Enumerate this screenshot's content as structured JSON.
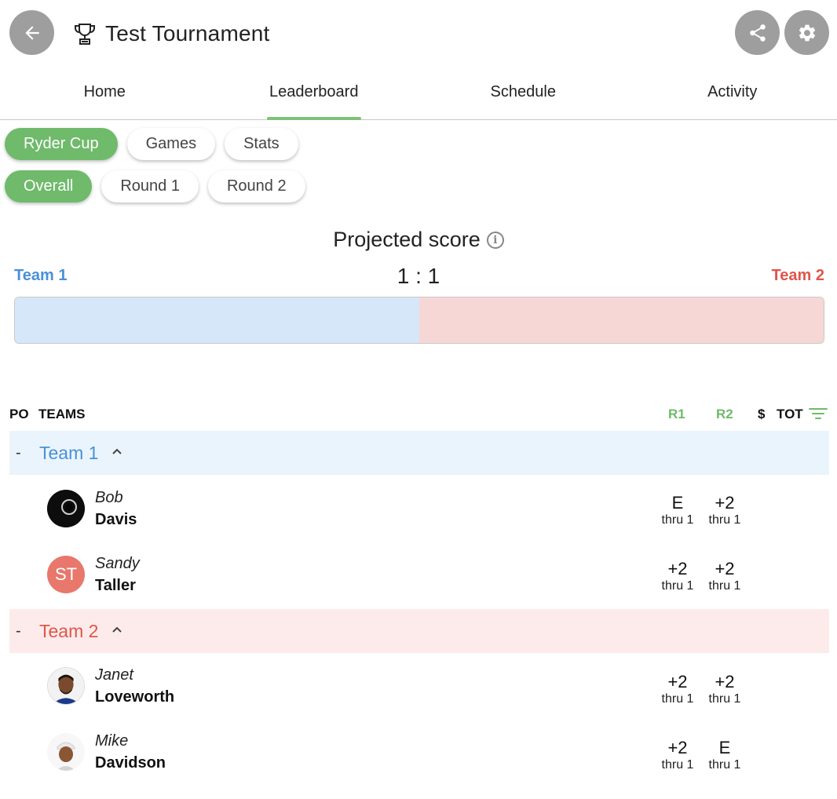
{
  "header": {
    "title": "Test Tournament",
    "icons": {
      "back": "arrow-left-icon",
      "trophy": "trophy-icon",
      "share": "share-icon",
      "settings": "gear-icon"
    }
  },
  "tabs": [
    {
      "label": "Home",
      "active": false
    },
    {
      "label": "Leaderboard",
      "active": true
    },
    {
      "label": "Schedule",
      "active": false
    },
    {
      "label": "Activity",
      "active": false
    }
  ],
  "format_chips": [
    {
      "label": "Ryder Cup",
      "active": true
    },
    {
      "label": "Games",
      "active": false
    },
    {
      "label": "Stats",
      "active": false
    }
  ],
  "round_chips": [
    {
      "label": "Overall",
      "active": true
    },
    {
      "label": "Round 1",
      "active": false
    },
    {
      "label": "Round 2",
      "active": false
    }
  ],
  "projected": {
    "title": "Projected score",
    "team1": "Team 1",
    "team2": "Team 2",
    "score": "1 : 1",
    "team1_share": 0.5
  },
  "table": {
    "headers": {
      "po": "PO",
      "teams": "TEAMS",
      "r1": "R1",
      "r2": "R2",
      "money": "$",
      "tot": "TOT"
    },
    "groups": [
      {
        "dash": "-",
        "name": "Team 1",
        "players": [
          {
            "first": "Bob",
            "last": "Davis",
            "r1": "E",
            "r1_thru": "thru 1",
            "r2": "+2",
            "r2_thru": "thru 1"
          },
          {
            "first": "Sandy",
            "last": "Taller",
            "initials": "ST",
            "r1": "+2",
            "r1_thru": "thru 1",
            "r2": "+2",
            "r2_thru": "thru 1"
          }
        ]
      },
      {
        "dash": "-",
        "name": "Team 2",
        "players": [
          {
            "first": "Janet",
            "last": "Loveworth",
            "r1": "+2",
            "r1_thru": "thru 1",
            "r2": "+2",
            "r2_thru": "thru 1"
          },
          {
            "first": "Mike",
            "last": "Davidson",
            "r1": "+2",
            "r1_thru": "thru 1",
            "r2": "E",
            "r2_thru": "thru 1"
          }
        ]
      }
    ]
  },
  "colors": {
    "accent_green": "#6fba6b",
    "team1_blue": "#4a90d9",
    "team2_red": "#e0554a"
  }
}
